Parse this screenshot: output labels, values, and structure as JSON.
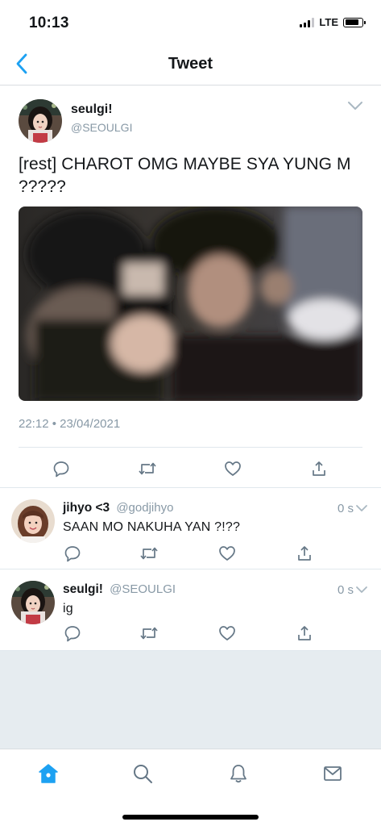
{
  "status_bar": {
    "time": "10:13",
    "network": "LTE",
    "signal_bars_active": 3,
    "battery_fraction": 0.8
  },
  "nav": {
    "title": "Tweet",
    "back_icon": "chevron-left-icon"
  },
  "main_tweet": {
    "display_name": "seulgi!",
    "handle": "@SEOULGI",
    "text": "[rest] CHAROT OMG MAYBE SYA YUNG M ?????",
    "timestamp": "22:12 • 23/04/2021",
    "media": "blurred-mirror-selfie-photo",
    "actions": [
      "reply-icon",
      "retweet-icon",
      "like-icon",
      "share-icon"
    ]
  },
  "replies": [
    {
      "display_name": "jihyo <3",
      "handle": "@godjihyo",
      "time": "0 s",
      "text": "SAAN MO NAKUHA YAN ?!??"
    },
    {
      "display_name": "seulgi!",
      "handle": "@SEOULGI",
      "time": "0 s",
      "text": "ig"
    }
  ],
  "tab_bar": {
    "tabs": [
      "home-icon",
      "search-icon",
      "notifications-icon",
      "messages-icon"
    ],
    "active": "home-icon"
  },
  "colors": {
    "accent": "#1da1f2",
    "secondary_text": "#8899a6",
    "divider": "#e1e8ed",
    "background_fill": "#e6ecf0"
  }
}
